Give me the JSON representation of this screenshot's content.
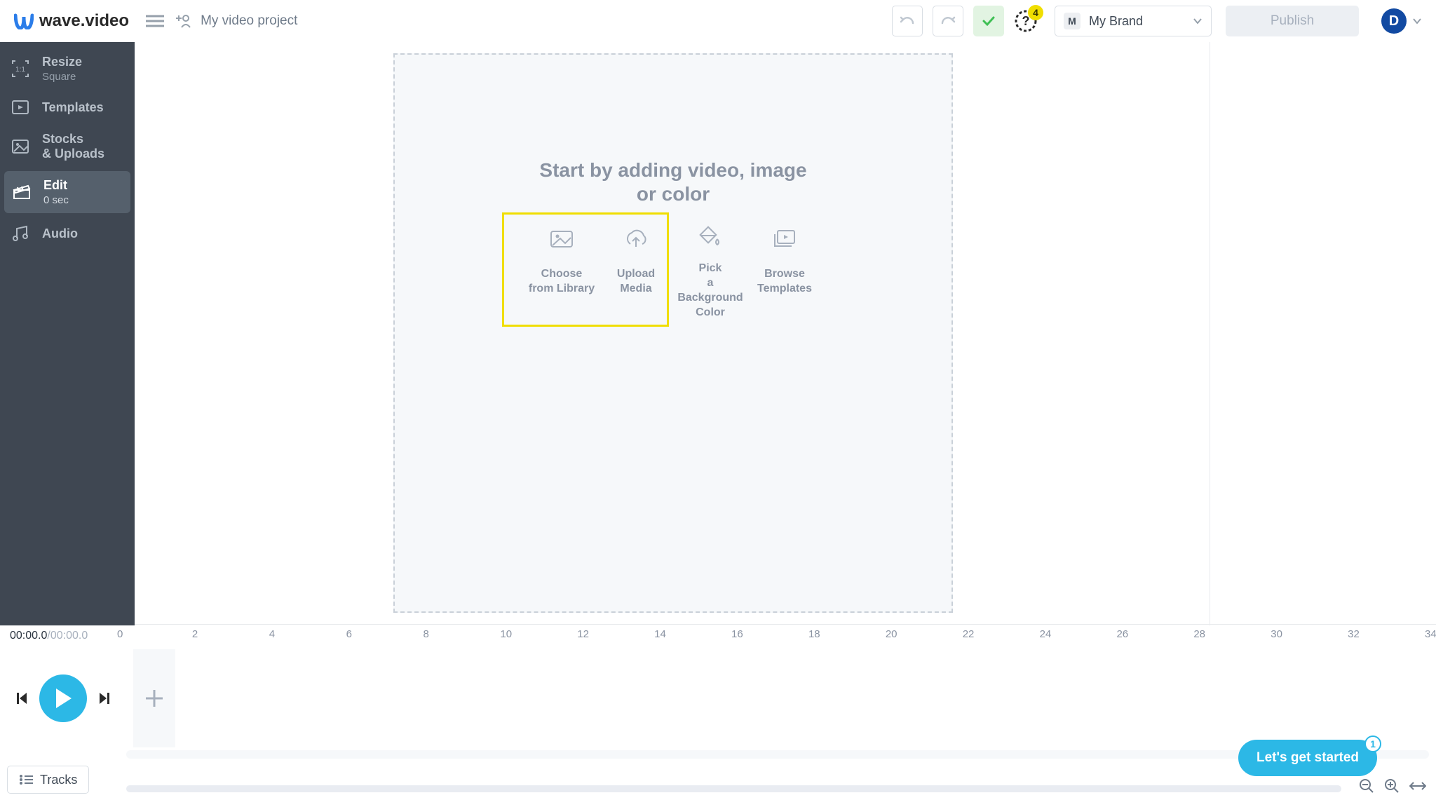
{
  "header": {
    "logo_text": "wave.video",
    "project_title": "My video project",
    "notification_count": "4",
    "brand": {
      "chip": "M",
      "label": "My Brand"
    },
    "publish_label": "Publish",
    "avatar_initial": "D"
  },
  "sidebar": {
    "items": [
      {
        "label": "Resize",
        "sub": "Square"
      },
      {
        "label": "Templates"
      },
      {
        "label": "Stocks\n& Uploads"
      },
      {
        "label": "Edit",
        "sub": "0 sec",
        "active": true
      },
      {
        "label": "Audio"
      }
    ]
  },
  "canvas": {
    "heading_line1": "Start by adding video, image",
    "heading_line2": "or color",
    "options": [
      {
        "line1": "Choose",
        "line2": "from Library"
      },
      {
        "line1": "Upload",
        "line2": "Media"
      },
      {
        "line1": "Pick",
        "line2": "a Background",
        "line3": "Color"
      },
      {
        "line1": "Browse",
        "line2": "Templates"
      }
    ]
  },
  "timeline": {
    "timecode_current": "00:00.0",
    "timecode_total": "/00:00.0",
    "ruler": [
      "0",
      "2",
      "4",
      "6",
      "8",
      "10",
      "12",
      "14",
      "16",
      "18",
      "20",
      "22",
      "24",
      "26",
      "28",
      "30",
      "32",
      "34"
    ],
    "tracks_label": "Tracks"
  },
  "help_pill": {
    "label": "Let's get started",
    "count": "1"
  }
}
